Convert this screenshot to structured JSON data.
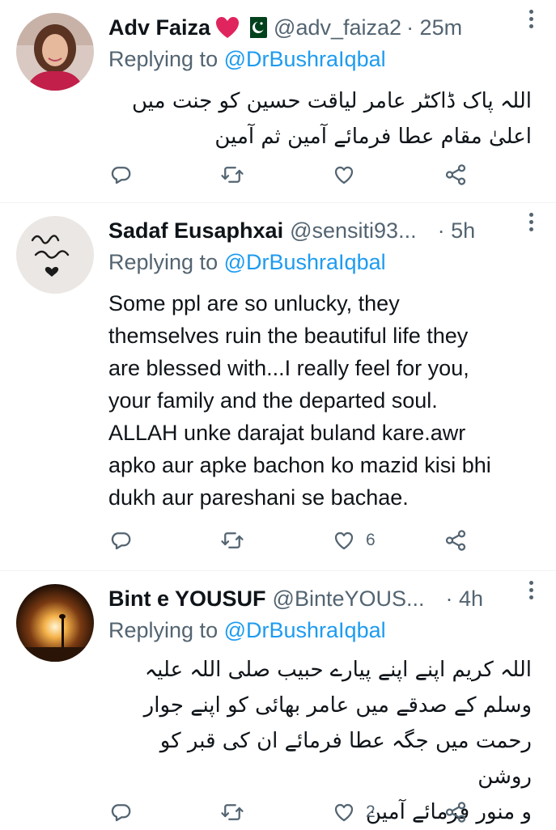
{
  "tweets": [
    {
      "display_name": "Adv Faiza",
      "handle": "@adv_faiza2",
      "time": "· 25m",
      "badges": [
        "red-heart-icon",
        "pakistan-flag-icon"
      ],
      "replying_label": "Replying to",
      "replying_to": "@DrBushraIqbal",
      "text": "اللہ پاک ڈاکٹر عامر لیاقت حسین کو جنت میں\nاعلیٰ مقام عطا فرمائے آمین ثم آمین",
      "direction": "rtl",
      "like_count": ""
    },
    {
      "display_name": "Sadaf Eusaphxai",
      "handle": "@sensiti93...",
      "time": "· 5h",
      "badges": [],
      "replying_label": "Replying to",
      "replying_to": "@DrBushraIqbal",
      "text": "Some ppl are so unlucky, they\nthemselves ruin the beautiful life they\nare blessed with...I really feel for you,\nyour family and the departed soul.\nALLAH unke darajat buland kare.awr\napko aur apke bachon ko mazid kisi bhi\ndukh aur pareshani se bachae.",
      "direction": "ltr",
      "like_count": "6"
    },
    {
      "display_name": "Bint e YOUSUF",
      "handle": "@BinteYOUS...",
      "time": "· 4h",
      "badges": [],
      "replying_label": "Replying to",
      "replying_to": "@DrBushraIqbal",
      "text": "اللہ کریم اپنے اپنے پیارے حبیب صلی اللہ علیہ\nوسلم کے صدقے میں عامر بھائی کو اپنے جوار\nرحمت میں جگہ عطا فرمائے ان کی قبر کو روشن\nو منور فرمائے آمین",
      "direction": "rtl",
      "like_count": "2"
    }
  ],
  "icons": {
    "reply": "reply-icon",
    "retweet": "retweet-icon",
    "like": "like-icon",
    "share": "share-icon",
    "more": "more-options-icon"
  },
  "colors": {
    "link": "#1d9bf0",
    "secondary_text": "#536471",
    "primary_text": "#0f1419",
    "divider": "#eff3f4",
    "heart": "#e0245e",
    "flag_green": "#01411c"
  }
}
